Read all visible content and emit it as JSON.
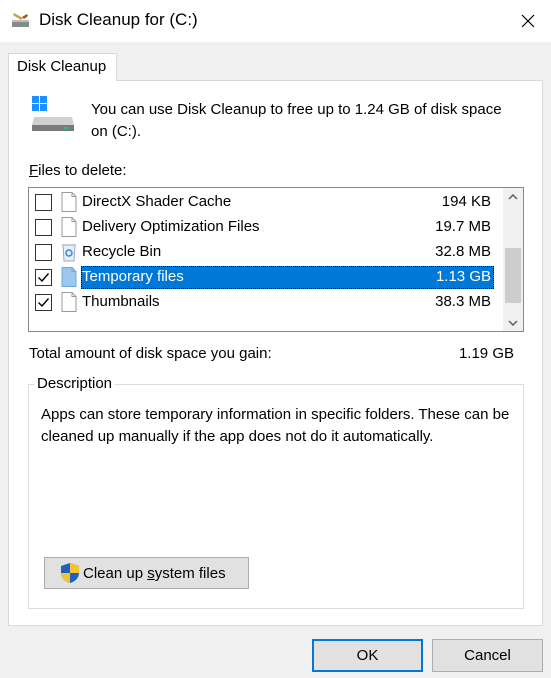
{
  "window": {
    "title": "Disk Cleanup for  (C:)",
    "icons": {
      "title": "disk-cleanup-icon",
      "close": "close-icon"
    }
  },
  "tab": {
    "label": "Disk Cleanup"
  },
  "intro": {
    "text": "You can use Disk Cleanup to free up to 1.24 GB of disk space on  (C:).",
    "icon": "drive-icon"
  },
  "files": {
    "label_access": "F",
    "label_rest": "iles to delete:",
    "items": [
      {
        "name": "DirectX Shader Cache",
        "size": "194 KB",
        "checked": false,
        "icon": "file-icon"
      },
      {
        "name": "Delivery Optimization Files",
        "size": "19.7 MB",
        "checked": false,
        "icon": "file-icon"
      },
      {
        "name": "Recycle Bin",
        "size": "32.8 MB",
        "checked": false,
        "icon": "recycle-bin-icon"
      },
      {
        "name": "Temporary files",
        "size": "1.13 GB",
        "checked": true,
        "selected": true,
        "icon": "file-icon"
      },
      {
        "name": "Thumbnails",
        "size": "38.3 MB",
        "checked": true,
        "icon": "file-icon"
      }
    ]
  },
  "total": {
    "label": "Total amount of disk space you gain:",
    "value": "1.19 GB"
  },
  "description": {
    "legend": "Description",
    "text": "Apps can store temporary information in specific folders. These can be cleaned up manually if the app does not do it automatically."
  },
  "buttons": {
    "cleanup_before": "Clean up ",
    "cleanup_access": "s",
    "cleanup_after": "ystem files",
    "ok": "OK",
    "cancel": "Cancel"
  },
  "colors": {
    "selection": "#0078d7",
    "default_button_border": "#0078d7"
  }
}
